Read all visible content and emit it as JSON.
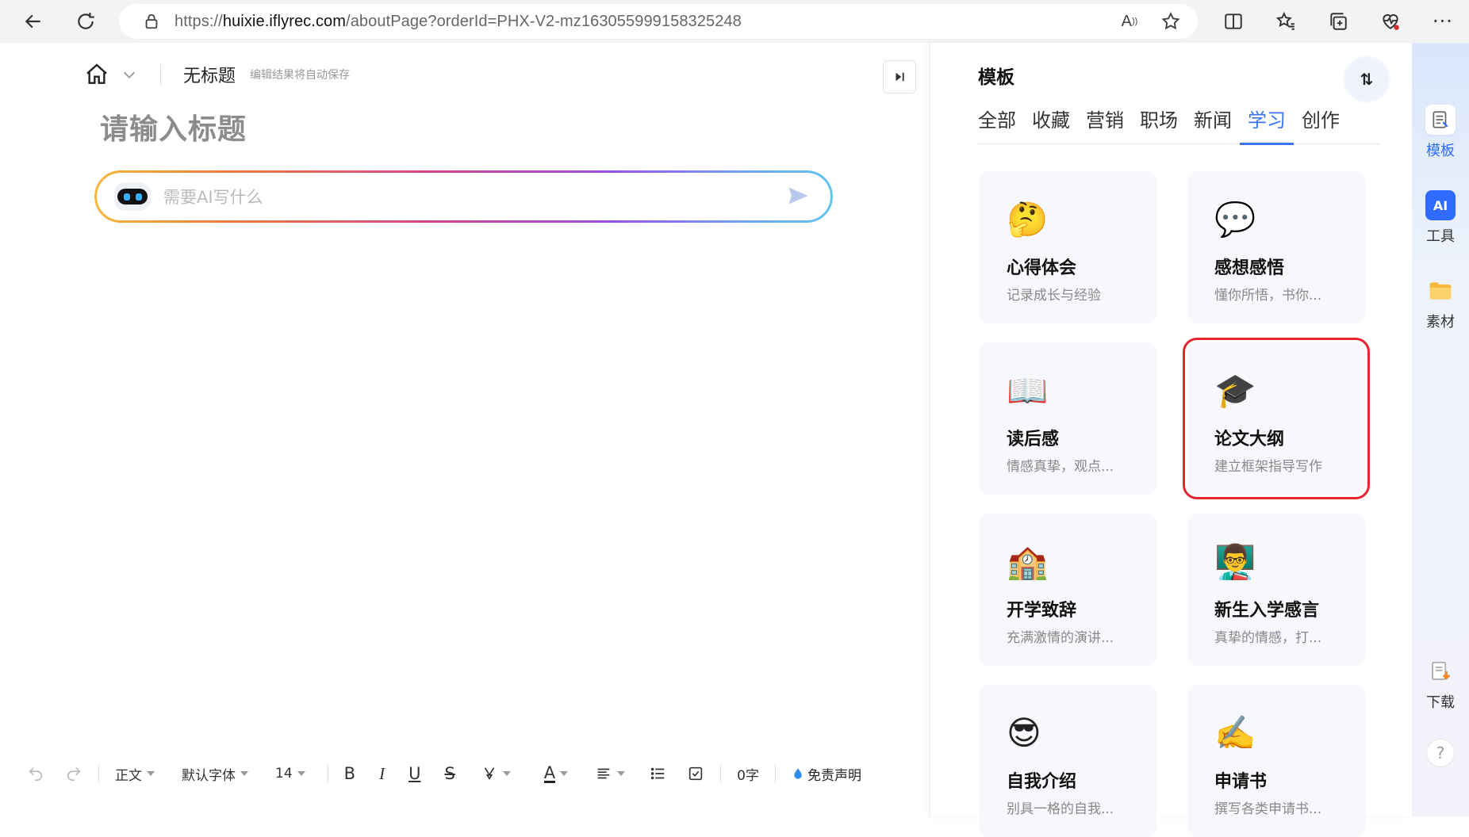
{
  "browser": {
    "url_prefix": "https://",
    "url_host": "huixie.iflyrec.com",
    "url_path": "/aboutPage?orderId=PHX-V2-mz163055999158325248"
  },
  "editor": {
    "doc_title": "无标题",
    "autosave_hint": "编辑结果将自动保存",
    "title_placeholder": "请输入标题",
    "ai_placeholder": "需要AI写什么"
  },
  "toolbar": {
    "paragraph_style": "正文",
    "font_family": "默认字体",
    "font_size": "14",
    "bold": "B",
    "italic": "I",
    "underline": "U",
    "strike": "S",
    "font_color": "A",
    "word_count": "0字",
    "disclaimer": "免责声明"
  },
  "panel": {
    "title": "模板",
    "sort_label": "⇅",
    "tabs": [
      {
        "label": "全部"
      },
      {
        "label": "收藏"
      },
      {
        "label": "营销"
      },
      {
        "label": "职场"
      },
      {
        "label": "新闻"
      },
      {
        "label": "学习",
        "active": true
      },
      {
        "label": "创作"
      }
    ],
    "cards": [
      {
        "emoji": "🤔",
        "name": "心得体会",
        "desc": "记录成长与经验"
      },
      {
        "emoji": "💬",
        "name": "感想感悟",
        "desc": "懂你所悟，书你..."
      },
      {
        "emoji": "📖",
        "name": "读后感",
        "desc": "情感真挚，观点..."
      },
      {
        "emoji": "🎓",
        "name": "论文大纲",
        "desc": "建立框架指导写作",
        "highlighted": true
      },
      {
        "emoji": "🏫",
        "name": "开学致辞",
        "desc": "充满激情的演讲..."
      },
      {
        "emoji": "👨‍🏫",
        "name": "新生入学感言",
        "desc": "真挚的情感，打..."
      },
      {
        "emoji": "😎",
        "name": "自我介绍",
        "desc": "别具一格的自我..."
      },
      {
        "emoji": "✍️",
        "name": "申请书",
        "desc": "撰写各类申请书..."
      }
    ]
  },
  "rail": {
    "items": [
      {
        "label": "模板",
        "icon": "template-icon",
        "active": true
      },
      {
        "label": "工具",
        "icon": "ai-tool-icon",
        "badge": "AI"
      },
      {
        "label": "素材",
        "icon": "folder-icon"
      },
      {
        "label": "下载",
        "icon": "download-icon"
      }
    ],
    "help": "?"
  },
  "colors": {
    "accent": "#3b74f0",
    "highlight_border": "#e8242f"
  }
}
